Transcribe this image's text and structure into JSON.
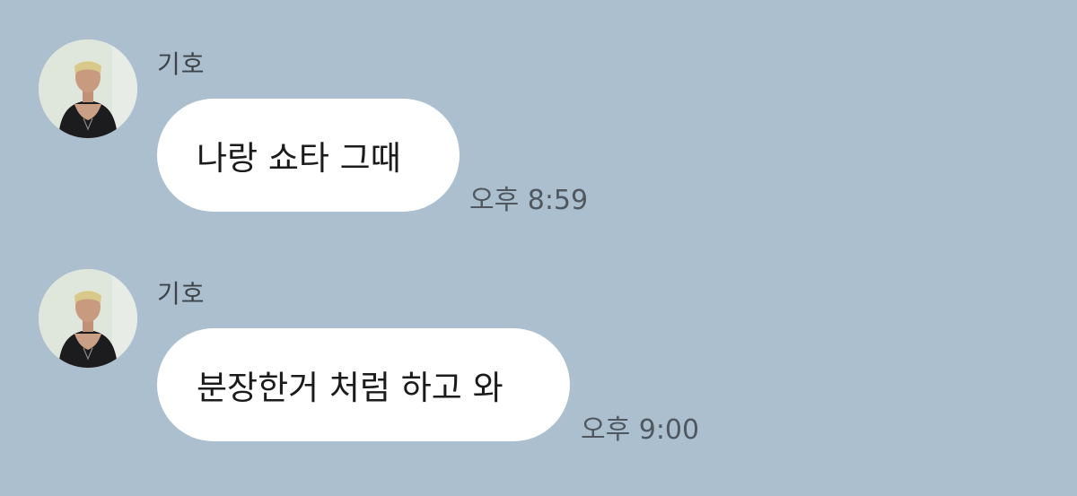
{
  "theme": {
    "background": "#abbfcf",
    "bubble": "#ffffff"
  },
  "messages": [
    {
      "sender": "기호",
      "text": "나랑 쇼타 그때",
      "time": "오후 8:59",
      "avatar_icon": "profile-photo-icon"
    },
    {
      "sender": "기호",
      "text": "분장한거 처럼 하고 와",
      "time": "오후 9:00",
      "avatar_icon": "profile-photo-icon"
    }
  ]
}
